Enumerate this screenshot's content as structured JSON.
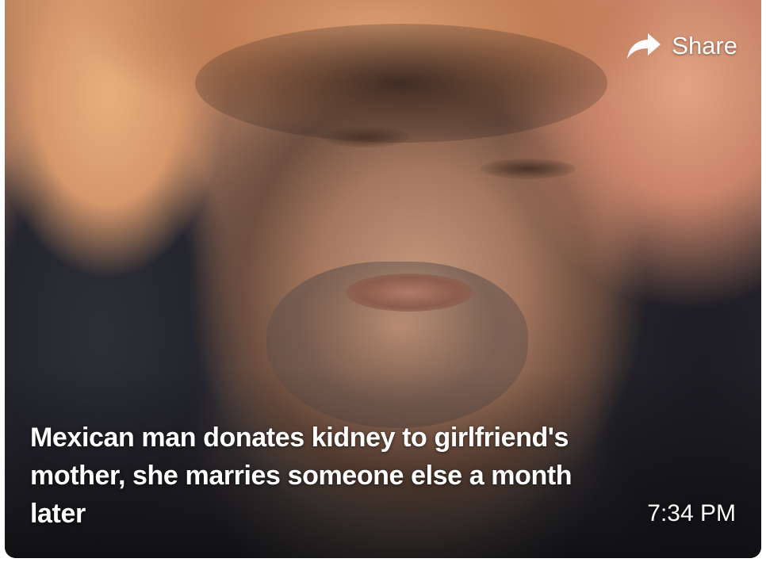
{
  "card": {
    "share_label": "Share",
    "share_icon": "share-arrow-icon",
    "headline": "Mexican man donates kidney to girlfriend's mother, she marries someone else a month later",
    "timestamp": "7:34 PM"
  }
}
